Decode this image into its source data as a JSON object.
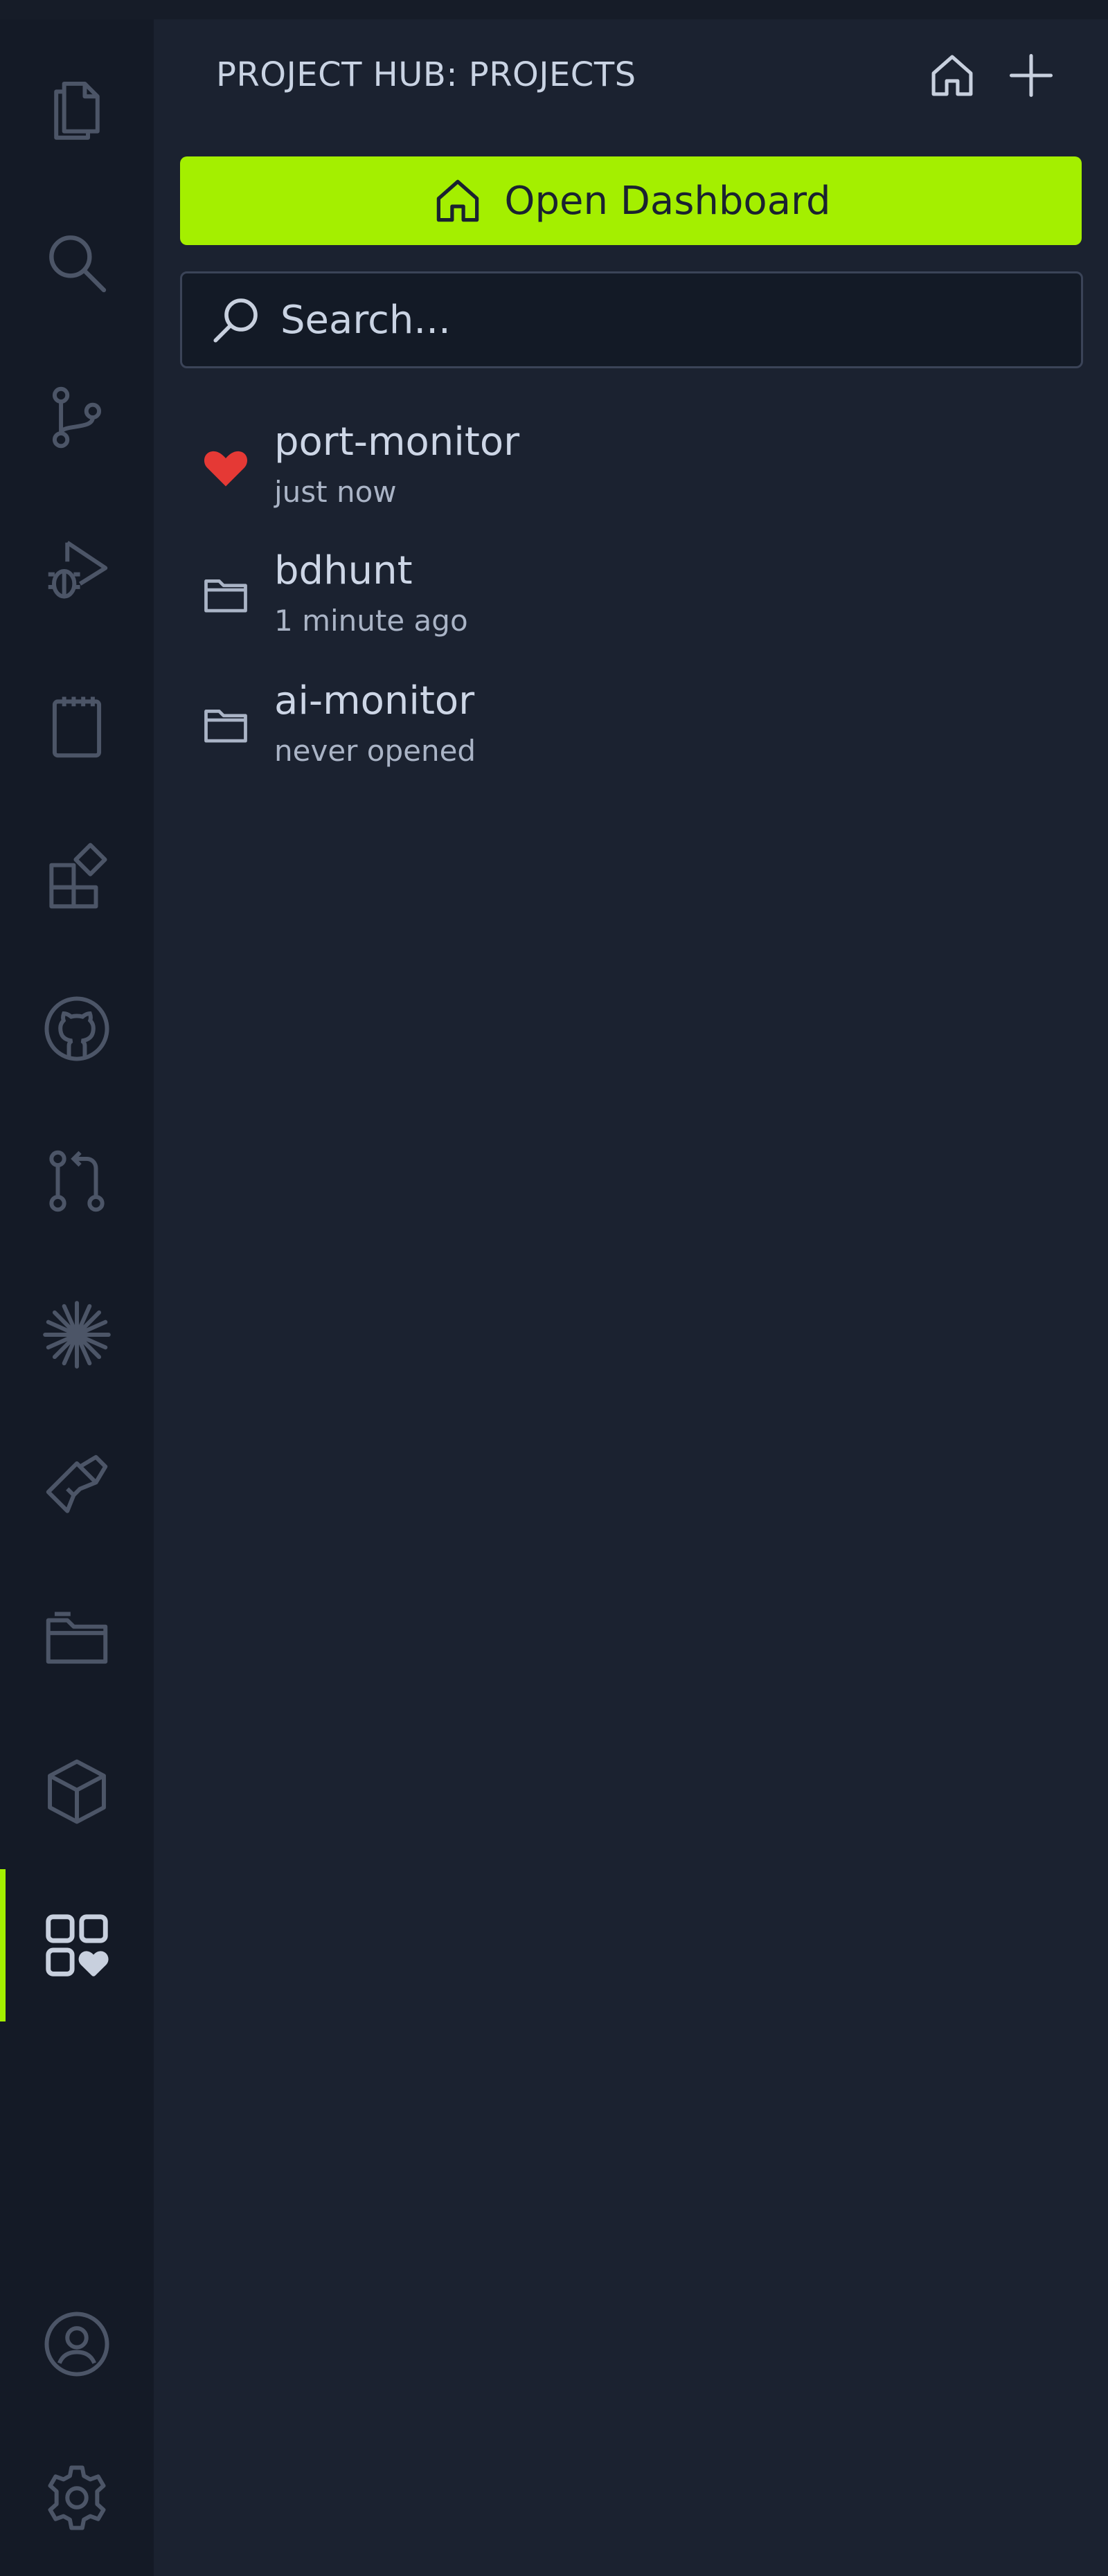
{
  "activity_bar": {
    "items": [
      {
        "icon": "files-icon"
      },
      {
        "icon": "search-icon"
      },
      {
        "icon": "source-control-icon"
      },
      {
        "icon": "run-debug-icon"
      },
      {
        "icon": "notebook-icon"
      },
      {
        "icon": "extensions-icon"
      },
      {
        "icon": "github-icon"
      },
      {
        "icon": "pull-request-icon"
      },
      {
        "icon": "sparkle-icon"
      },
      {
        "icon": "bowtie-icon"
      },
      {
        "icon": "folders-icon"
      },
      {
        "icon": "package-icon"
      },
      {
        "icon": "project-hub-icon",
        "active": true
      }
    ],
    "bottom_items": [
      {
        "icon": "account-icon"
      },
      {
        "icon": "settings-gear-icon"
      }
    ],
    "active_indicator_color": "#a3f000"
  },
  "sidebar": {
    "title": "PROJECT HUB: PROJECTS",
    "actions": [
      {
        "icon": "home-icon"
      },
      {
        "icon": "add-icon"
      }
    ],
    "open_dashboard": {
      "label": "Open Dashboard",
      "icon": "home-icon",
      "background": "#a4ef00"
    },
    "search": {
      "placeholder": "Search...",
      "value": ""
    },
    "projects": [
      {
        "name": "port-monitor",
        "time": "just now",
        "icon": "heart-icon",
        "icon_color": "#e53935"
      },
      {
        "name": "bdhunt",
        "time": "1 minute ago",
        "icon": "folder-icon"
      },
      {
        "name": "ai-monitor",
        "time": "never opened",
        "icon": "folder-icon"
      }
    ]
  }
}
